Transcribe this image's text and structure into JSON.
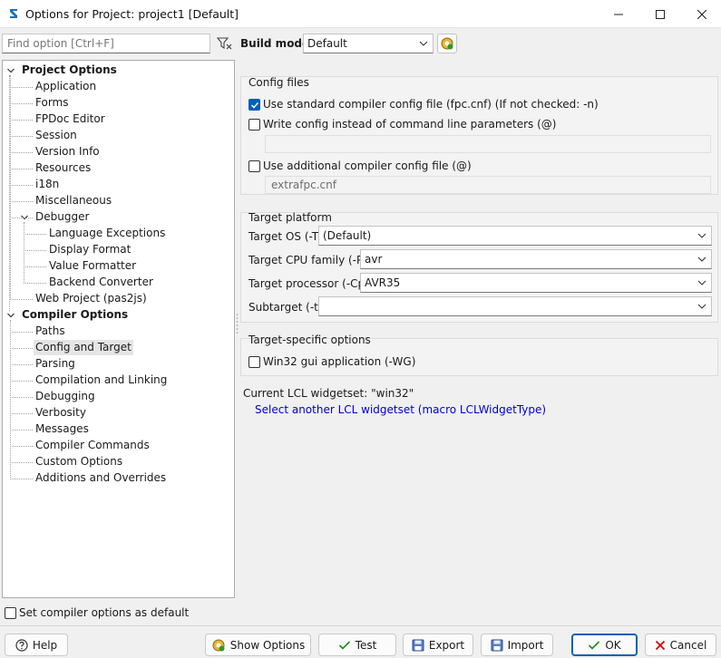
{
  "window": {
    "title": "Options for Project: project1 [Default]"
  },
  "left": {
    "find_placeholder": "Find option [Ctrl+F]",
    "tree": [
      {
        "label": "Project Options",
        "bold": true,
        "level": 0,
        "expanded": true
      },
      {
        "label": "Application",
        "level": 1
      },
      {
        "label": "Forms",
        "level": 1
      },
      {
        "label": "FPDoc Editor",
        "level": 1
      },
      {
        "label": "Session",
        "level": 1
      },
      {
        "label": "Version Info",
        "level": 1
      },
      {
        "label": "Resources",
        "level": 1
      },
      {
        "label": "i18n",
        "level": 1
      },
      {
        "label": "Miscellaneous",
        "level": 1
      },
      {
        "label": "Debugger",
        "level": 1,
        "expanded": true
      },
      {
        "label": "Language Exceptions",
        "level": 2
      },
      {
        "label": "Display Format",
        "level": 2
      },
      {
        "label": "Value Formatter",
        "level": 2
      },
      {
        "label": "Backend Converter",
        "level": 2
      },
      {
        "label": "Web Project (pas2js)",
        "level": 1
      },
      {
        "label": "Compiler Options",
        "bold": true,
        "level": 0,
        "expanded": true
      },
      {
        "label": "Paths",
        "level": 1
      },
      {
        "label": "Config and Target",
        "level": 1,
        "selected": true
      },
      {
        "label": "Parsing",
        "level": 1
      },
      {
        "label": "Compilation and Linking",
        "level": 1
      },
      {
        "label": "Debugging",
        "level": 1
      },
      {
        "label": "Verbosity",
        "level": 1
      },
      {
        "label": "Messages",
        "level": 1
      },
      {
        "label": "Compiler Commands",
        "level": 1
      },
      {
        "label": "Custom Options",
        "level": 1
      },
      {
        "label": "Additions and Overrides",
        "level": 1
      }
    ],
    "set_default_label": "Set compiler options as default",
    "set_default_checked": false
  },
  "build_mode": {
    "label": "Build mode",
    "value": "Default"
  },
  "config_files": {
    "title": "Config files",
    "use_standard_label": "Use standard compiler config file (fpc.cnf) (If not checked: -n)",
    "use_standard_checked": true,
    "write_config_label": "Write config instead of command line parameters (@)",
    "write_config_checked": false,
    "write_config_path": "",
    "use_additional_label": "Use additional compiler config file (@)",
    "use_additional_checked": false,
    "additional_path": "extrafpc.cnf"
  },
  "target_platform": {
    "title": "Target platform",
    "os_label": "Target OS (-T)",
    "os_value": "(Default)",
    "cpu_label": "Target CPU family (-P)",
    "cpu_value": "avr",
    "processor_label": "Target processor (-Cp)",
    "processor_value": "AVR35",
    "subtarget_label": "Subtarget (-t)",
    "subtarget_value": ""
  },
  "target_specific": {
    "title": "Target-specific options",
    "win32_gui_label": "Win32 gui application (-WG)",
    "win32_gui_checked": false
  },
  "lcl": {
    "current_label": "Current LCL widgetset: \"win32\"",
    "select_link": "Select another LCL widgetset (macro LCLWidgetType)"
  },
  "buttons": {
    "help": "Help",
    "show_options": "Show Options",
    "test": "Test",
    "export": "Export",
    "import": "Import",
    "ok": "OK",
    "cancel": "Cancel"
  },
  "colors": {
    "accent": "#005fb8",
    "link": "#0000cc",
    "ok_check": "#1a8a1a",
    "cancel_x": "#d40000"
  }
}
